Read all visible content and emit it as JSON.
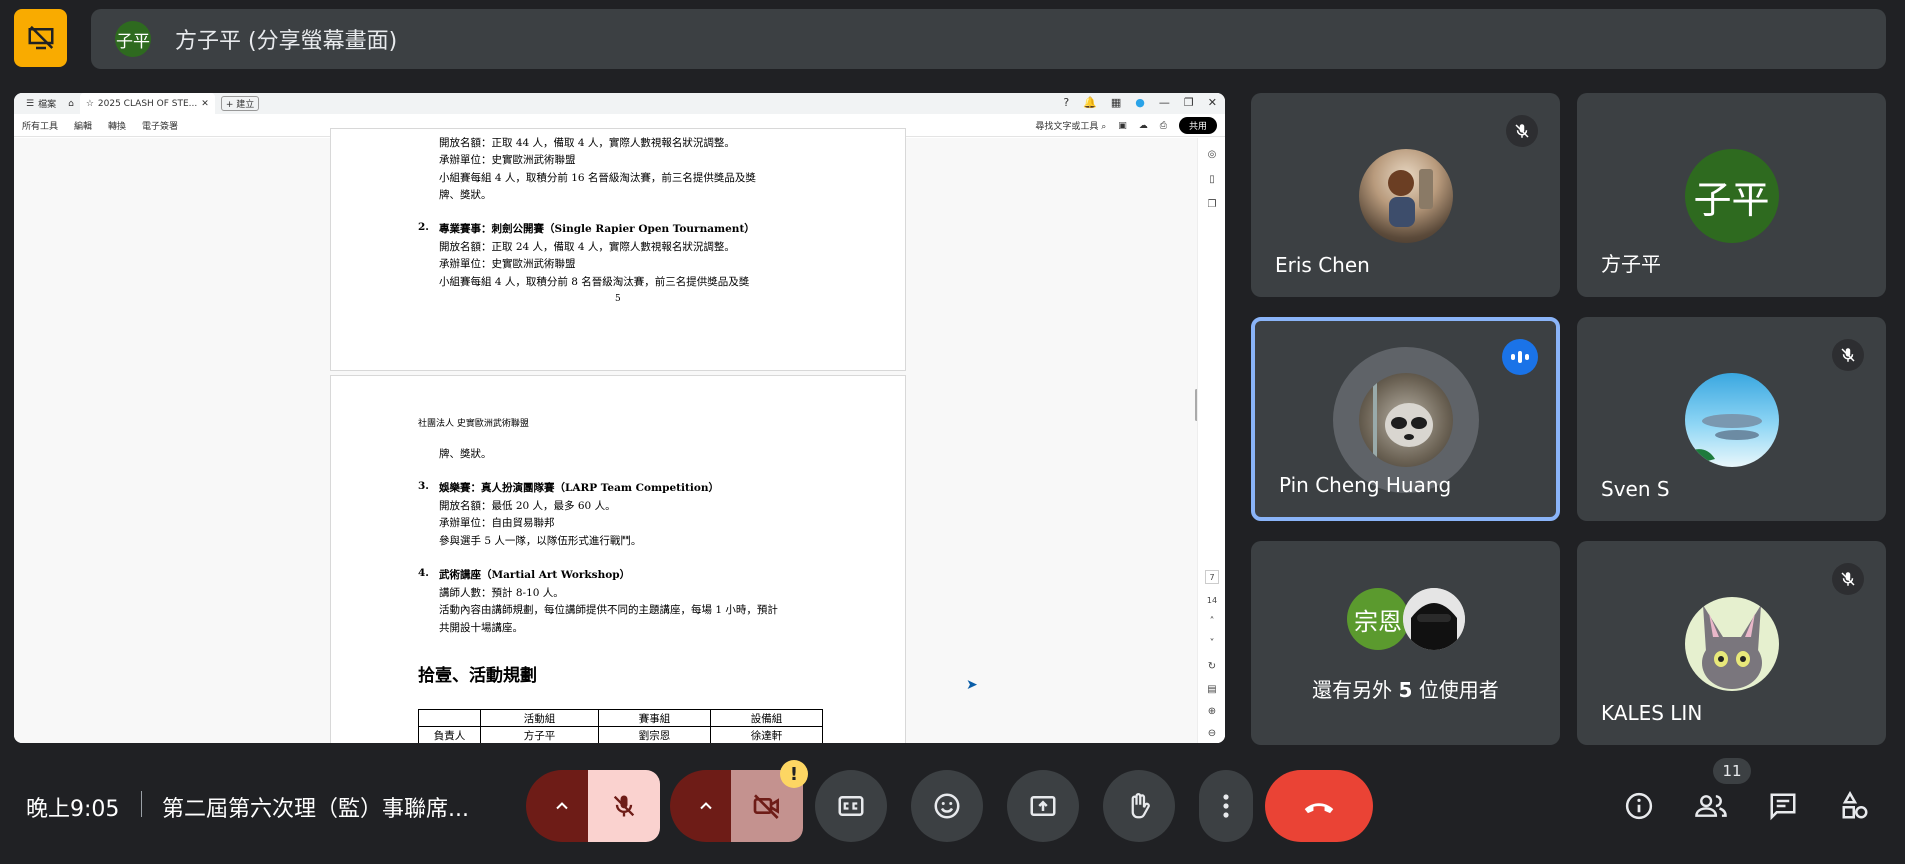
{
  "top_bar": {
    "presenter_initials": "子平",
    "presenter_text": "方子平 (分享螢幕畫面)"
  },
  "browser": {
    "menu_label": "檔案",
    "tab_title": "2025 CLASH OF STE...",
    "new_tab_label": "+ 建立"
  },
  "pdf_toolbar": {
    "items": [
      "所有工具",
      "編輯",
      "轉換",
      "電子簽署"
    ],
    "search_label": "尋找文字或工具",
    "share_label": "共用"
  },
  "pdf_page1": {
    "lines": [
      "開放名額：正取 44 人，備取 4 人，實際人數視報名狀況調整。",
      "承辦單位：史實歐洲武術聯盟",
      "小組賽每組 4 人，取積分前 16 名晉級淘汰賽，前三名提供獎品及獎",
      "牌、獎狀。",
      "2.",
      "專業賽事：刺劍公開賽（Single Rapier Open Tournament）",
      "開放名額：正取 24 人，備取 4 人，實際人數視報名狀況調整。",
      "承辦單位：史實歐洲武術聯盟",
      "小組賽每組 4 人，取積分前 8 名晉級淘汰賽，前三名提供獎品及獎",
      "5"
    ]
  },
  "pdf_page2": {
    "header": "社團法人 史實歐洲武術聯盟",
    "lines": [
      "牌、獎狀。",
      "3.",
      "娛樂賽：真人扮演團隊賽（LARP Team Competition）",
      "開放名額：最低 20 人，最多 60 人。",
      "承辦單位：自由貿易聯邦",
      "參與選手 5 人一隊，以隊伍形式進行戰鬥。",
      "4.",
      "武術講座（Martial Art Workshop）",
      "講師人數：預計 8-10 人。",
      "活動內容由講師規劃，每位講師提供不同的主題講座，每場 1 小時，預計",
      "共開設十場講座。"
    ],
    "section_heading": "拾壹、活動規劃",
    "table": {
      "headers": [
        "",
        "活動組",
        "賽事組",
        "設備組"
      ],
      "row": [
        "負責人",
        "方子平",
        "劉宗恩",
        "徐達軒"
      ]
    }
  },
  "pdf_rail": {
    "page_current": "7",
    "page_total": "14"
  },
  "participants": {
    "eris": {
      "name": "Eris Chen"
    },
    "zip": {
      "name": "方子平",
      "initials": "子平"
    },
    "pin": {
      "name": "Pin Cheng Huang"
    },
    "sven": {
      "name": "Sven S"
    },
    "others": {
      "initials": "宗恩",
      "text_prefix": "還有另外 ",
      "count": "5",
      "text_suffix": " 位使用者"
    },
    "kales": {
      "name": "KALES LIN"
    }
  },
  "bottom_bar": {
    "time": "晚上9:05",
    "meeting_title": "第二屆第六次理（監）事聯席...",
    "participant_count": "11",
    "camera_warning": "!"
  },
  "colors": {
    "background": "#202124",
    "tile": "#3c4043",
    "end_call": "#ea4335",
    "mute_active": "#fad2cf",
    "mute_dark": "#6e1c17",
    "logo_badge": "#f9ab00",
    "speaking_border": "#8ab4f8",
    "talk_badge": "#1a73e8"
  },
  "icons": {
    "logo": "screen-share-off-icon",
    "mic": "mic-off-icon",
    "camera": "camera-off-icon",
    "captions": "captions-icon",
    "emoji": "emoji-icon",
    "present": "present-screen-icon",
    "hand": "raise-hand-icon",
    "more": "more-vert-icon",
    "end": "call-end-icon",
    "info": "info-icon",
    "people": "people-icon",
    "chat": "chat-icon",
    "activities": "activities-icon"
  }
}
